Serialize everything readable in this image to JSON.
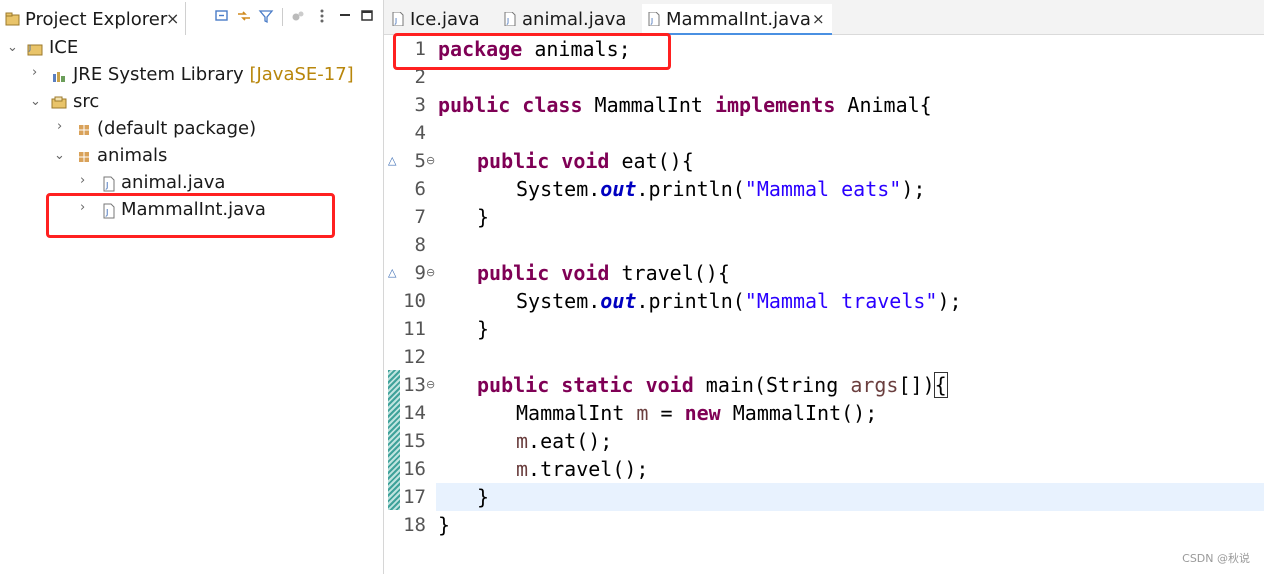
{
  "explorer": {
    "title": "Project Explorer",
    "close": "×",
    "toolbar": [
      "collapse-all-icon",
      "link-with-editor-icon",
      "filter-icon",
      "focus-icon",
      "view-menu-icon",
      "minimize-icon",
      "maximize-icon"
    ],
    "tree": [
      {
        "label": "ICE",
        "icon": "project-icon",
        "expanded": true
      },
      {
        "label": "JRE System Library",
        "decoration": "[JavaSE-17]",
        "icon": "library-icon",
        "expanded": false
      },
      {
        "label": "src",
        "icon": "source-folder-icon",
        "expanded": true
      },
      {
        "label": "(default package)",
        "icon": "package-icon",
        "expanded": false
      },
      {
        "label": "animals",
        "icon": "package-icon",
        "expanded": true
      },
      {
        "label": "animal.java",
        "icon": "java-file-icon",
        "expanded": false
      },
      {
        "label": "MammalInt.java",
        "icon": "java-file-icon",
        "expanded": false
      }
    ]
  },
  "editor": {
    "tabs": [
      {
        "label": "Ice.java",
        "active": false
      },
      {
        "label": "animal.java",
        "active": false
      },
      {
        "label": "MammalInt.java",
        "active": true,
        "close": "×"
      }
    ],
    "line_numbers": [
      "1",
      "2",
      "3",
      "4",
      "5",
      "6",
      "7",
      "8",
      "9",
      "10",
      "11",
      "12",
      "13",
      "14",
      "15",
      "16",
      "17",
      "18"
    ],
    "code": {
      "l1_kw": "package",
      "l1_rest": " animals;",
      "l3_kw1": "public",
      "l3_kw2": "class",
      "l3_name": " MammalInt ",
      "l3_kw3": "implements",
      "l3_rest": " Animal{",
      "l5_kw1": "public",
      "l5_kw2": "void",
      "l5_rest": " eat(){",
      "l6_a": "System.",
      "l6_field": "out",
      "l6_b": ".println(",
      "l6_str": "\"Mammal eats\"",
      "l6_c": ");",
      "l7": "}",
      "l9_kw1": "public",
      "l9_kw2": "void",
      "l9_rest": " travel(){",
      "l10_a": "System.",
      "l10_field": "out",
      "l10_b": ".println(",
      "l10_str": "\"Mammal travels\"",
      "l10_c": ");",
      "l11": "}",
      "l13_kw1": "public",
      "l13_kw2": "static",
      "l13_kw3": "void",
      "l13_rest": " main(String ",
      "l13_var": "args",
      "l13_end": "[])",
      "l13_brace": "{",
      "l14_a": "MammalInt ",
      "l14_var": "m",
      "l14_b": " = ",
      "l14_kw": "new",
      "l14_c": " MammalInt();",
      "l15_var": "m",
      "l15_rest": ".eat();",
      "l16_var": "m",
      "l16_rest": ".travel();",
      "l17": "}",
      "l18": "}"
    },
    "fold_marker": "⊖",
    "override_marker": "△"
  },
  "watermark": "CSDN @秋说"
}
